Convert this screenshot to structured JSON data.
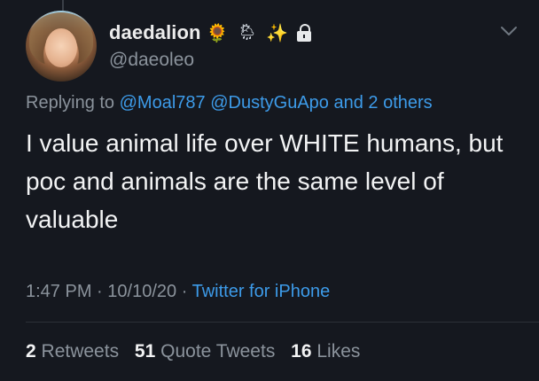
{
  "user": {
    "display_name": "daedalion",
    "emojis": {
      "sunflower": "🌻",
      "rain": "🌦",
      "sparkles": "✨",
      "lock": "lock-icon"
    },
    "handle": "@daeoleo"
  },
  "reply": {
    "prefix": "Replying to",
    "mention1": "@Moal787",
    "mention2": "@DustyGuApo",
    "suffix": "and 2 others"
  },
  "tweet": {
    "text": "I value animal life over WHITE humans, but poc and animals are the same level of valuable"
  },
  "meta": {
    "time": "1:47 PM",
    "date": "10/10/20",
    "separator": "·",
    "source": "Twitter for iPhone"
  },
  "stats": {
    "retweets_count": "2",
    "retweets_label": "Retweets",
    "quote_count": "51",
    "quote_label": "Quote Tweets",
    "likes_count": "16",
    "likes_label": "Likes"
  },
  "colors": {
    "background": "#15181f",
    "link": "#3d9be9",
    "muted": "#8b939c",
    "text": "#f2f3f4"
  }
}
